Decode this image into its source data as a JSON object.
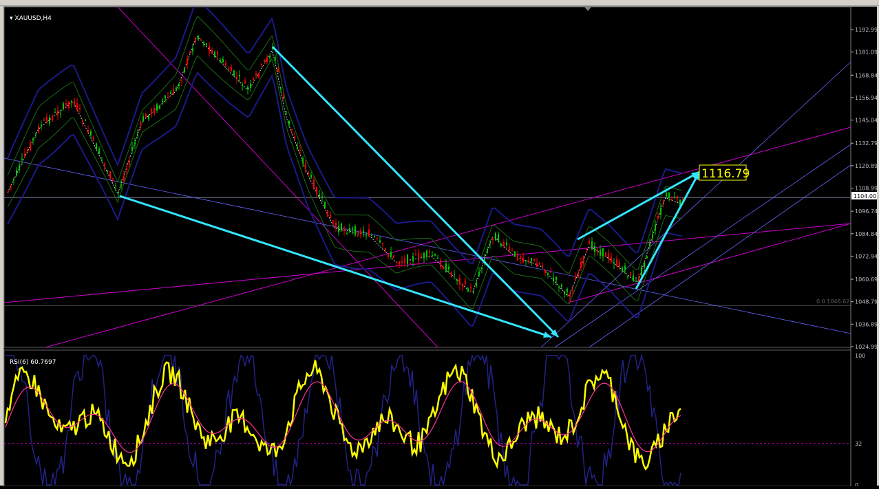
{
  "symbol_label": "XAUUSD,H4",
  "rsi_label": "RSI(6) 60.7697",
  "price_label": "1116.79",
  "current_price_tag": "1104.00",
  "fib_label": "0.0 1046.62",
  "chart_data": {
    "type": "line",
    "price_axis_ticks": [
      "1192.99",
      "1181.09",
      "1168.84",
      "1156.94",
      "1145.04",
      "1132.79",
      "1120.89",
      "1108.99",
      "1096.74",
      "1084.84",
      "1072.94",
      "1060.69",
      "1048.79",
      "1036.89",
      "1024.99"
    ],
    "ylim": [
      1024.99,
      1192.99
    ],
    "rsi_axis_ticks": [
      "100",
      "32",
      "0"
    ],
    "rsi_ylim": [
      0,
      100
    ],
    "colors": {
      "background": "#000000",
      "bull_candle": "#00cc00",
      "bear_candle": "#ff0000",
      "trend_arrows": "#33e6ff",
      "channel_lines": "#cc00cc",
      "fan_lines": "#6666ff",
      "rsi_line": "#ffff00",
      "rsi_signal": "#ff3399"
    }
  }
}
